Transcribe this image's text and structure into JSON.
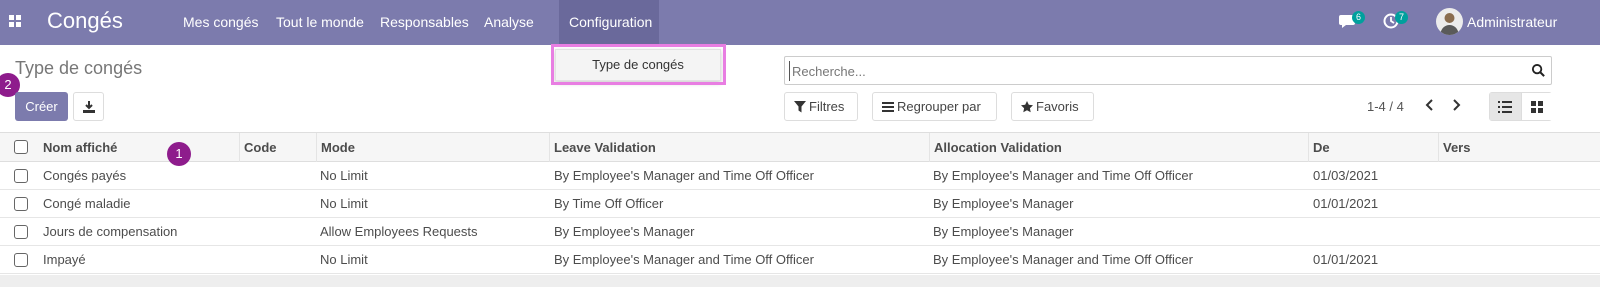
{
  "app": {
    "title": "Congés",
    "nav": [
      "Mes congés",
      "Tout le monde",
      "Responsables",
      "Analyse",
      "Configuration"
    ],
    "messages_count": "6",
    "activities_count": "7",
    "user_name": "Administrateur",
    "brand_color": "#7c7bad"
  },
  "dropdown": {
    "items": [
      "Type de congés"
    ]
  },
  "page": {
    "title": "Type de congés",
    "create_label": "Créer"
  },
  "step_badges": [
    "1",
    "2"
  ],
  "search": {
    "placeholder": "Recherche..."
  },
  "filters": {
    "filters_label": "Filtres",
    "group_label": "Regrouper par",
    "favorites_label": "Favoris"
  },
  "pager": {
    "text": "1-4 / 4"
  },
  "table": {
    "columns": [
      "Nom affiché",
      "Code",
      "Mode",
      "Leave Validation",
      "Allocation Validation",
      "De",
      "Vers"
    ],
    "rows": [
      [
        "Congés payés",
        "",
        "No Limit",
        "By Employee's Manager and Time Off Officer",
        "By Employee's Manager and Time Off Officer",
        "01/03/2021",
        ""
      ],
      [
        "Congé maladie",
        "",
        "No Limit",
        "By Time Off Officer",
        "By Employee's Manager",
        "01/01/2021",
        ""
      ],
      [
        "Jours de compensation",
        "",
        "Allow Employees Requests",
        "By Employee's Manager",
        "By Employee's Manager",
        "",
        ""
      ],
      [
        "Impayé",
        "",
        "No Limit",
        "By Employee's Manager and Time Off Officer",
        "By Employee's Manager and Time Off Officer",
        "01/01/2021",
        ""
      ]
    ]
  },
  "icons": [
    "apps-icon",
    "chat-icon",
    "activity-clock-icon",
    "download-icon",
    "search-icon",
    "filter-icon",
    "list-icon",
    "star-icon",
    "chevron-left-icon",
    "chevron-right-icon",
    "list-view-icon",
    "kanban-view-icon"
  ]
}
